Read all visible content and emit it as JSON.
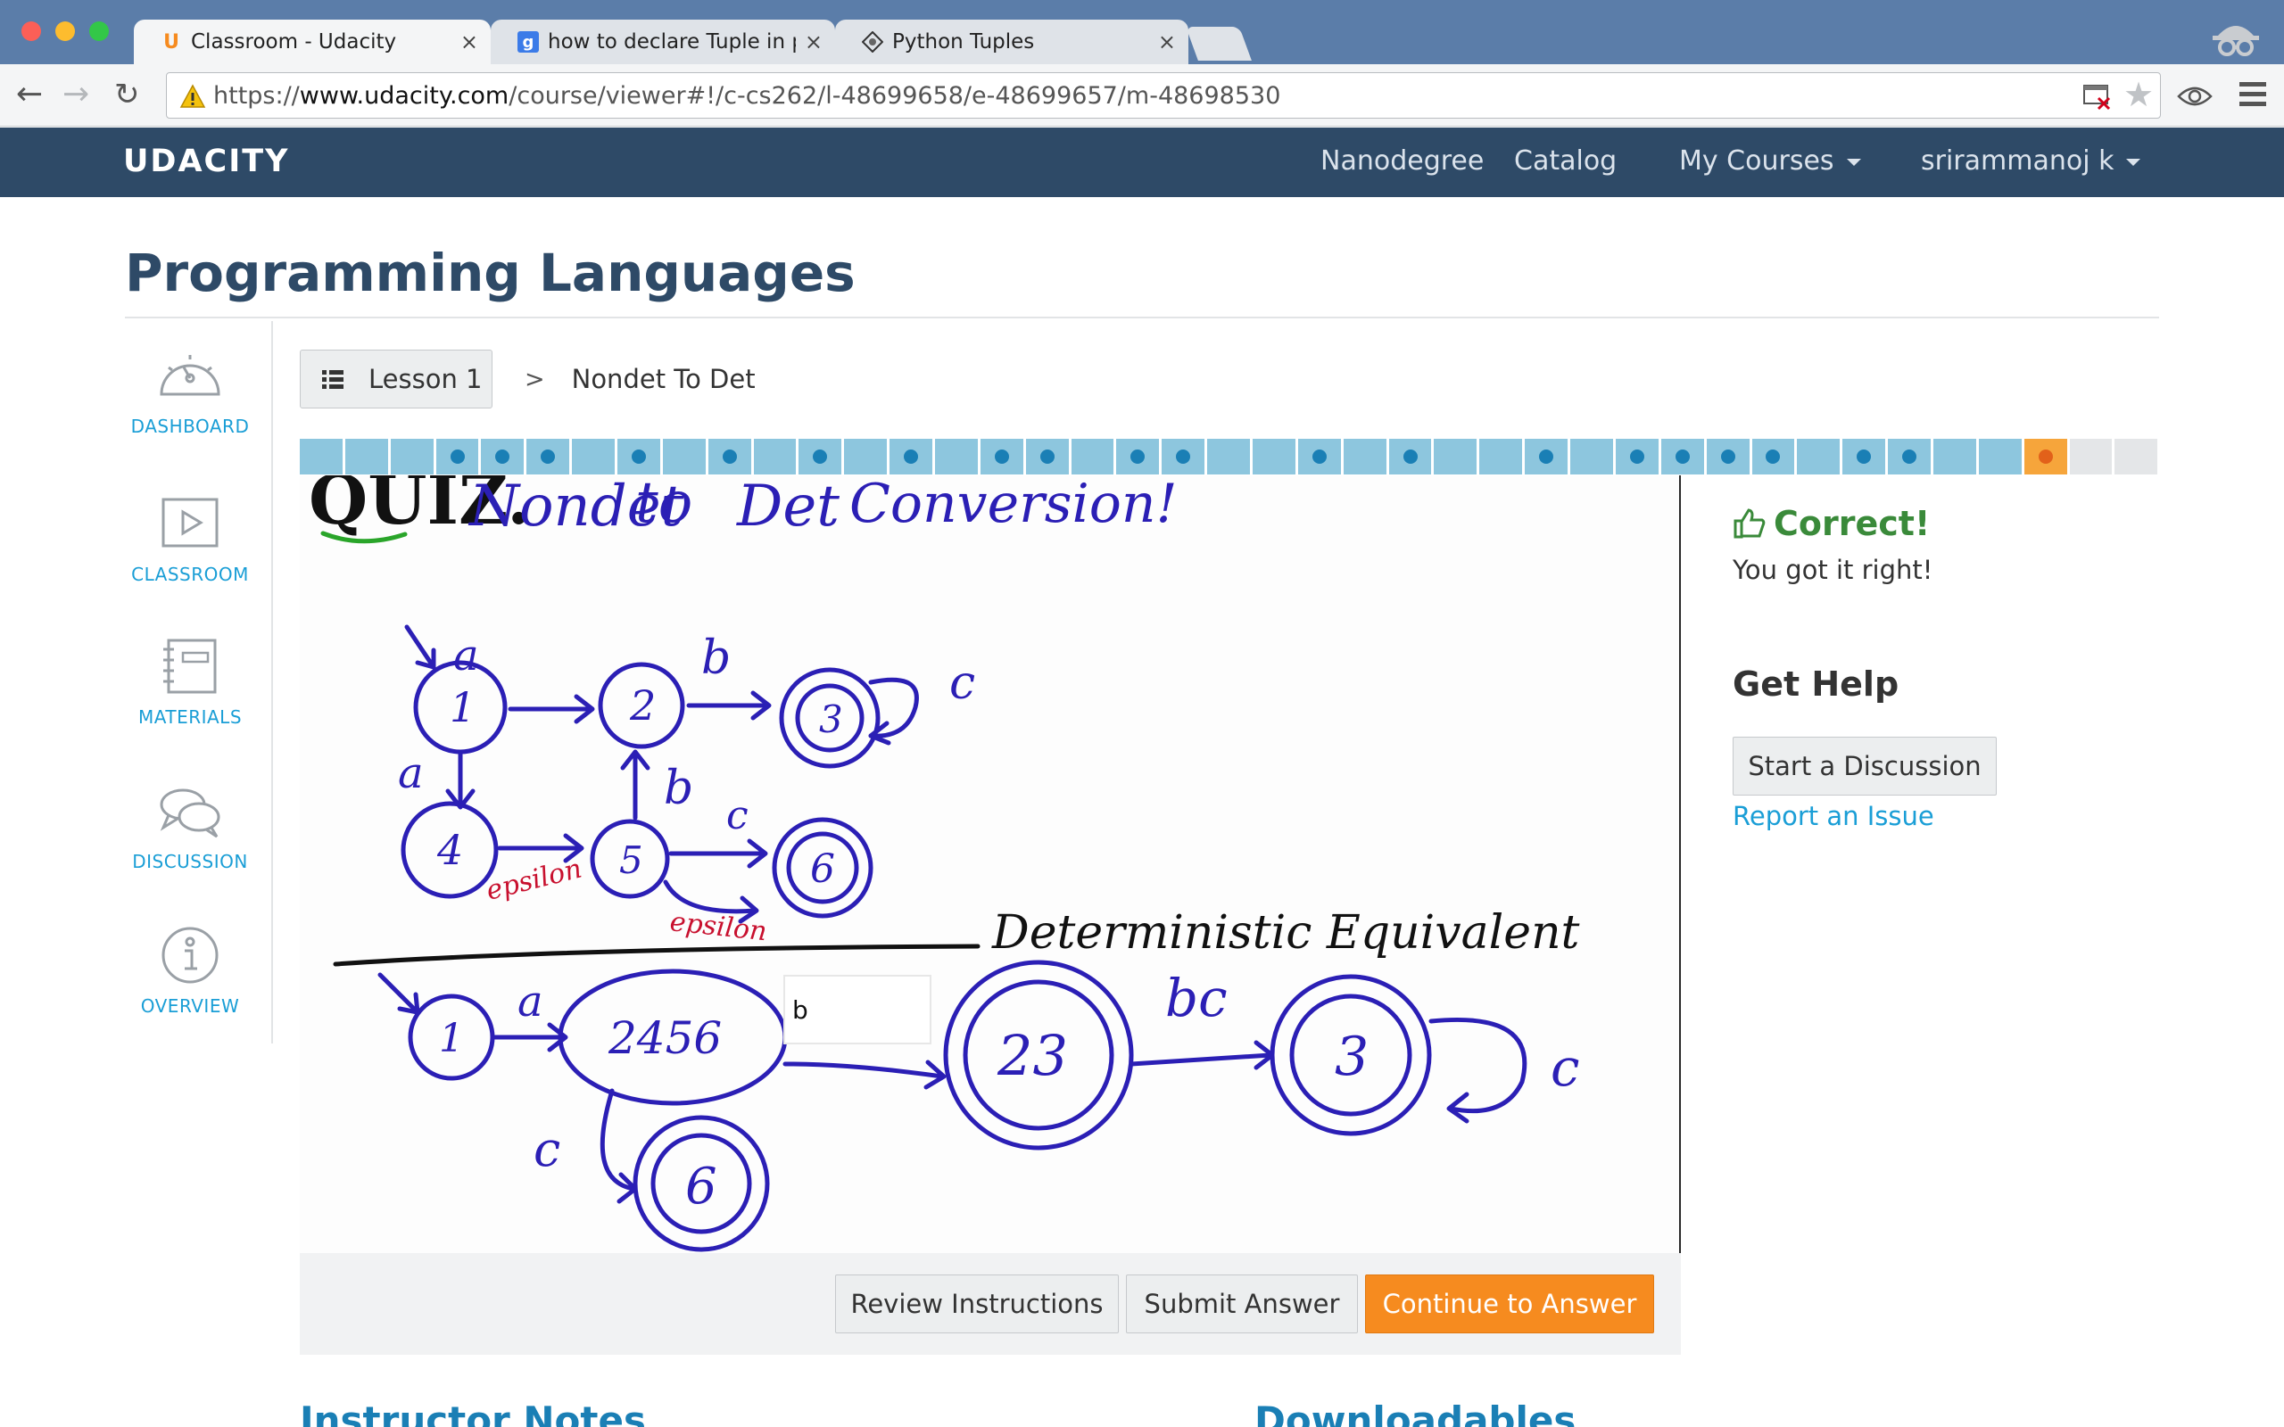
{
  "browser": {
    "tabs": [
      {
        "title": "Classroom - Udacity",
        "favicon": "udacity-u-icon"
      },
      {
        "title": "how to declare Tuple in pyt",
        "favicon": "google-g-icon"
      },
      {
        "title": "Python Tuples",
        "favicon": "python-logo-icon"
      }
    ],
    "url_scheme": "https://",
    "url_host": "www.udacity.com",
    "url_path": "/course/viewer#!/c-cs262/l-48699658/e-48699657/m-48698530"
  },
  "site": {
    "logo": "UDACITY",
    "nav": {
      "nanodegree": "Nanodegree",
      "catalog": "Catalog",
      "my_courses": "My Courses",
      "user": "srirammanoj k"
    }
  },
  "course": {
    "title": "Programming Languages"
  },
  "leftnav": {
    "dashboard": "DASHBOARD",
    "classroom": "CLASSROOM",
    "materials": "MATERIALS",
    "discussion": "DISCUSSION",
    "overview": "OVERVIEW"
  },
  "breadcrumb": {
    "lesson": "Lesson 1",
    "separator": ">",
    "current": "Nondet To Det"
  },
  "progress": {
    "segment_states": [
      "done",
      "done",
      "done",
      "done",
      "done",
      "done",
      "done",
      "done",
      "done",
      "done",
      "done",
      "done",
      "done",
      "done",
      "done",
      "done",
      "done",
      "done",
      "done",
      "done",
      "done",
      "done",
      "done",
      "done",
      "done",
      "done",
      "done",
      "done",
      "done",
      "done",
      "done",
      "done",
      "done",
      "done",
      "done",
      "done",
      "done",
      "done",
      "current",
      "todo",
      "todo"
    ],
    "segment_dots": [
      false,
      false,
      false,
      true,
      true,
      true,
      false,
      true,
      false,
      true,
      false,
      true,
      false,
      true,
      false,
      true,
      true,
      false,
      true,
      true,
      false,
      false,
      true,
      false,
      true,
      false,
      false,
      true,
      false,
      true,
      true,
      true,
      true,
      false,
      true,
      true,
      false,
      false,
      true,
      false,
      false
    ],
    "completed_color": "#8dc6de",
    "current_color": "#f6a53b",
    "todo_color": "#e4e6e8"
  },
  "quiz_whiteboard": {
    "heading": "QUIZ.",
    "title_words": [
      "Nondet",
      "to",
      "Det",
      "Conversion!"
    ],
    "nfa_states": [
      "1",
      "2",
      "3",
      "4",
      "5",
      "6"
    ],
    "nfa_labels": [
      "a",
      "b",
      "c",
      "a",
      "b",
      "c"
    ],
    "epsilon_labels": [
      "epsilon",
      "epsilon"
    ],
    "section_title": "Deterministic Equivalent",
    "dfa_states": [
      "1",
      "2456",
      "23",
      "3",
      "6"
    ],
    "dfa_labels": [
      "a",
      "bc",
      "c",
      "c"
    ],
    "ink_color": "#2b1fb5",
    "epsilon_color": "#c8102e"
  },
  "quiz": {
    "answer_value": "b"
  },
  "actions": {
    "review": "Review Instructions",
    "submit": "Submit Answer",
    "continue": "Continue to Answer"
  },
  "feedback": {
    "title": "Correct!",
    "message": "You got it right!"
  },
  "help": {
    "title": "Get Help",
    "discussion_button": "Start a Discussion",
    "report": "Report an Issue"
  },
  "sections": {
    "instructor_notes": "Instructor Notes",
    "downloadables": "Downloadables"
  }
}
